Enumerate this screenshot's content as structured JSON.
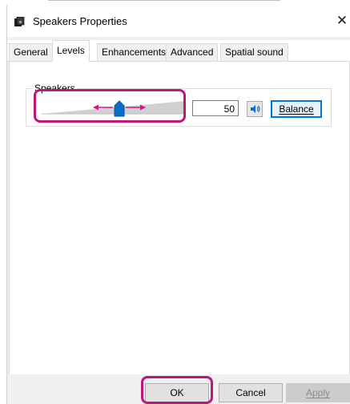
{
  "window": {
    "title": "Speakers Properties",
    "close_glyph": "✕"
  },
  "tabs": [
    {
      "label": "General",
      "active": false
    },
    {
      "label": "Levels",
      "active": true
    },
    {
      "label": "Enhancements",
      "active": false
    },
    {
      "label": "Advanced",
      "active": false
    },
    {
      "label": "Spatial sound",
      "active": false
    }
  ],
  "levels": {
    "group_label": "Speakers",
    "volume": "50",
    "mute_icon": "speaker-icon",
    "balance_label": "Balance",
    "slider_fraction": 0.5
  },
  "footer": {
    "ok_label": "OK",
    "cancel_label": "Cancel",
    "apply_label": "Apply"
  },
  "colors": {
    "highlight": "#c0157a",
    "accent": "#0078d7"
  }
}
